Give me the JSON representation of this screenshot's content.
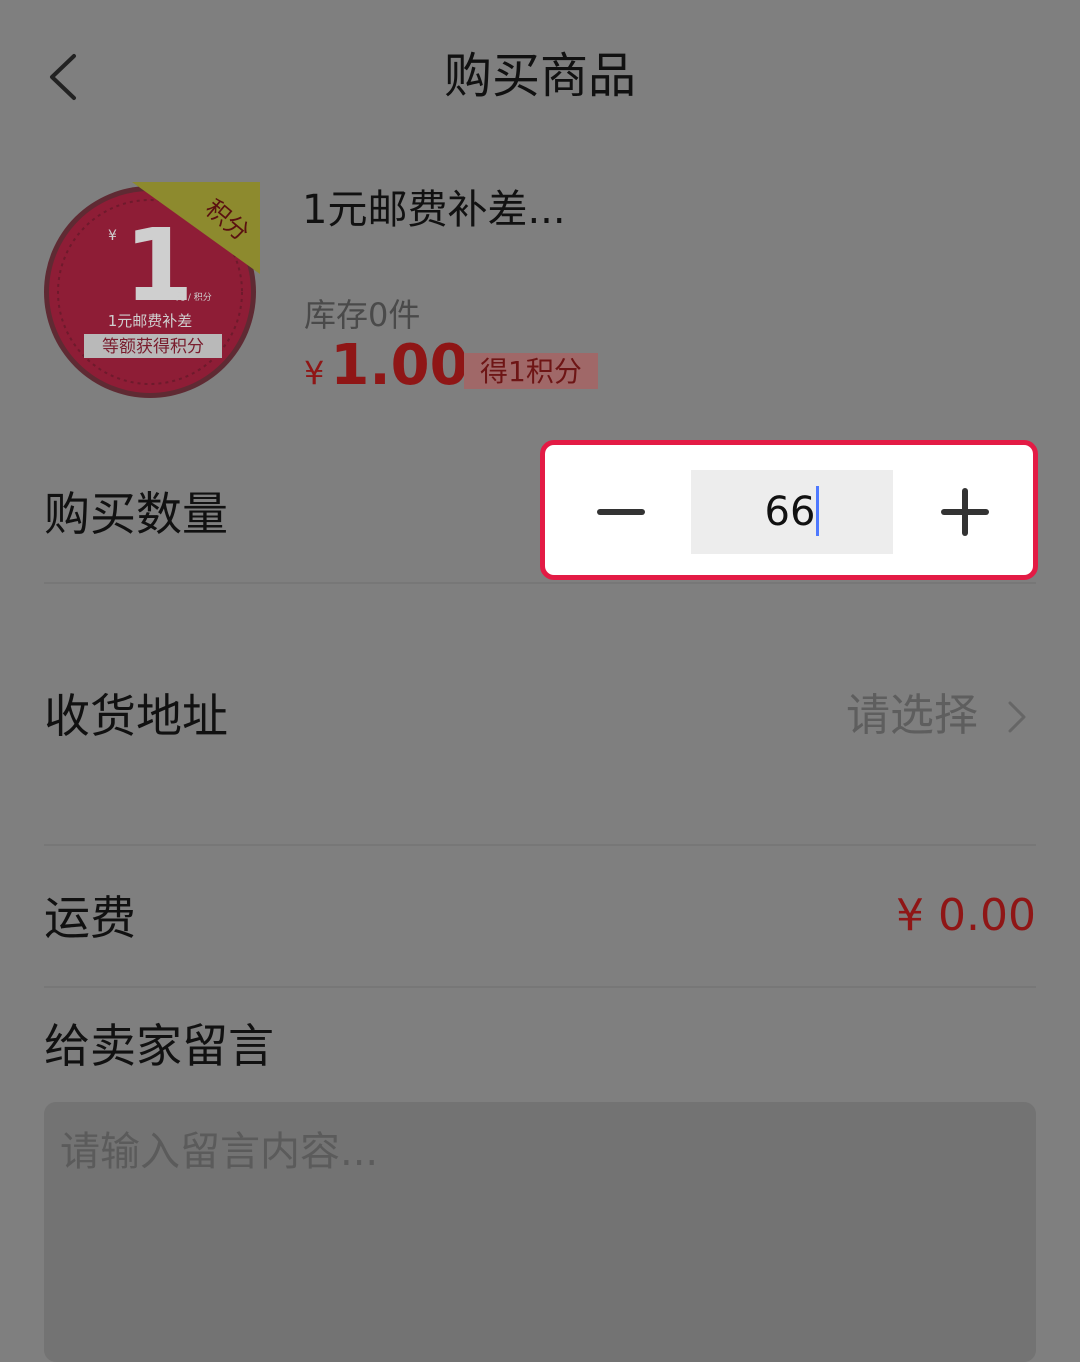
{
  "header": {
    "title": "购买商品"
  },
  "product": {
    "name": "1元邮费补差...",
    "stock": "库存0件",
    "currency": "¥",
    "price": "1.00",
    "points_badge": "得1积分",
    "thumbnail": {
      "ribbon": "积分",
      "yen": "¥",
      "big_number": "1",
      "unit": "元 / 积分",
      "line1": "1元邮费补差",
      "line2": "等额获得积分",
      "color": "#c8102e"
    }
  },
  "quantity": {
    "label": "购买数量",
    "value": "66"
  },
  "address": {
    "label": "收货地址",
    "value": "请选择"
  },
  "freight": {
    "label": "运费",
    "value": "¥ 0.00"
  },
  "message": {
    "label": "给卖家留言",
    "placeholder": "请输入留言内容..."
  },
  "colors": {
    "overlay": "#7f7f7f",
    "accent_red": "#8f1616",
    "highlight_border": "#e31b45"
  }
}
